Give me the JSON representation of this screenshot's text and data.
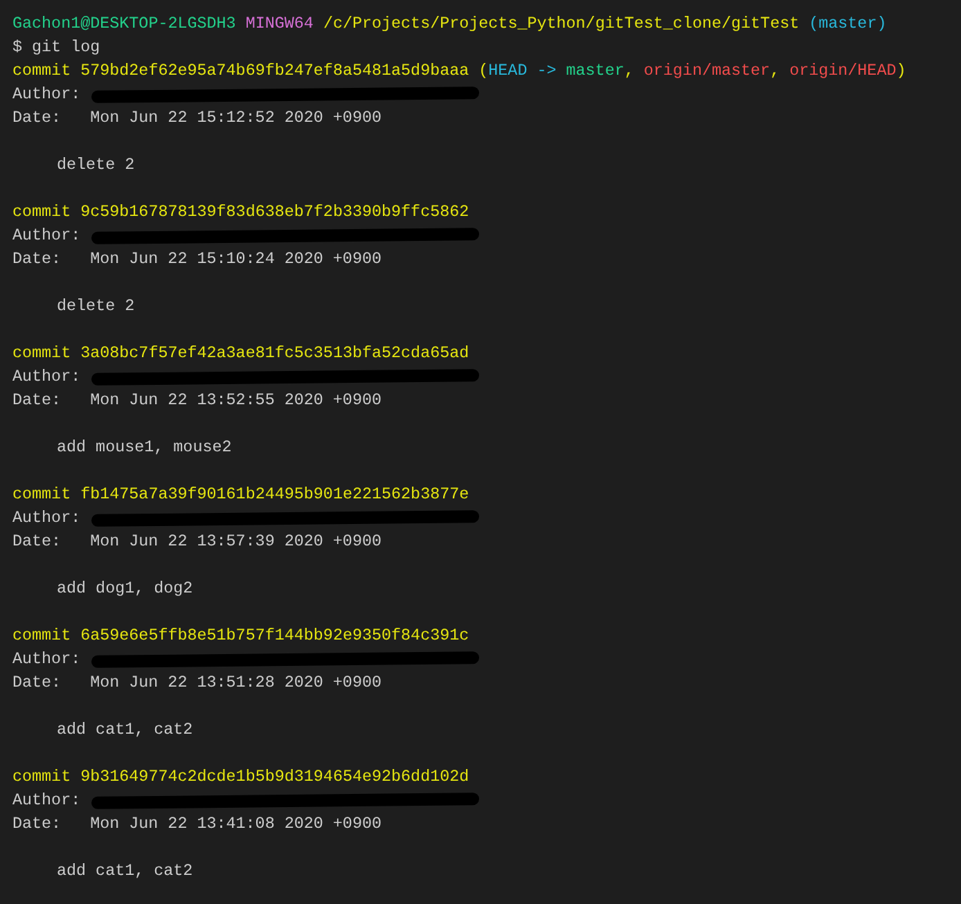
{
  "prompt": [
    {
      "kind": "user",
      "text": "Gachon1@DESKTOP-2LGSDH3"
    },
    {
      "kind": "system",
      "text": "MINGW64"
    },
    {
      "kind": "path",
      "text": "/c/Projects/Projects_Python/gitTest_clone/gitTest"
    },
    {
      "kind": "branch",
      "text": "(master)"
    }
  ],
  "command": "$ git log",
  "commits": [
    {
      "label": "commit",
      "hash": "579bd2ef62e95a74b69fb247ef8a5481a5d9baaa",
      "refs": [
        {
          "kind": "punct",
          "text": "("
        },
        {
          "kind": "head",
          "text": "HEAD ->"
        },
        {
          "kind": "local",
          "text": "master"
        },
        {
          "kind": "punct",
          "text": ","
        },
        {
          "kind": "remote",
          "text": "origin/master"
        },
        {
          "kind": "punct",
          "text": ","
        },
        {
          "kind": "remote",
          "text": "origin/HEAD"
        },
        {
          "kind": "punct",
          "text": ")"
        }
      ],
      "author_label": "Author:",
      "date_label": "Date:",
      "date": "Mon Jun 22 15:12:52 2020 +0900",
      "message": "delete 2"
    },
    {
      "label": "commit",
      "hash": "9c59b167878139f83d638eb7f2b3390b9ffc5862",
      "author_label": "Author:",
      "date_label": "Date:",
      "date": "Mon Jun 22 15:10:24 2020 +0900",
      "message": "delete 2"
    },
    {
      "label": "commit",
      "hash": "3a08bc7f57ef42a3ae81fc5c3513bfa52cda65ad",
      "author_label": "Author:",
      "date_label": "Date:",
      "date": "Mon Jun 22 13:52:55 2020 +0900",
      "message": "add mouse1, mouse2"
    },
    {
      "label": "commit",
      "hash": "fb1475a7a39f90161b24495b901e221562b3877e",
      "author_label": "Author:",
      "date_label": "Date:",
      "date": "Mon Jun 22 13:57:39 2020 +0900",
      "message": "add dog1, dog2"
    },
    {
      "label": "commit",
      "hash": "6a59e6e5ffb8e51b757f144bb92e9350f84c391c",
      "author_label": "Author:",
      "date_label": "Date:",
      "date": "Mon Jun 22 13:51:28 2020 +0900",
      "message": "add cat1, cat2"
    },
    {
      "label": "commit",
      "hash": "9b31649774c2dcde1b5b9d3194654e92b6dd102d",
      "author_label": "Author:",
      "date_label": "Date:",
      "date": "Mon Jun 22 13:41:08 2020 +0900",
      "message": "add cat1, cat2"
    }
  ]
}
